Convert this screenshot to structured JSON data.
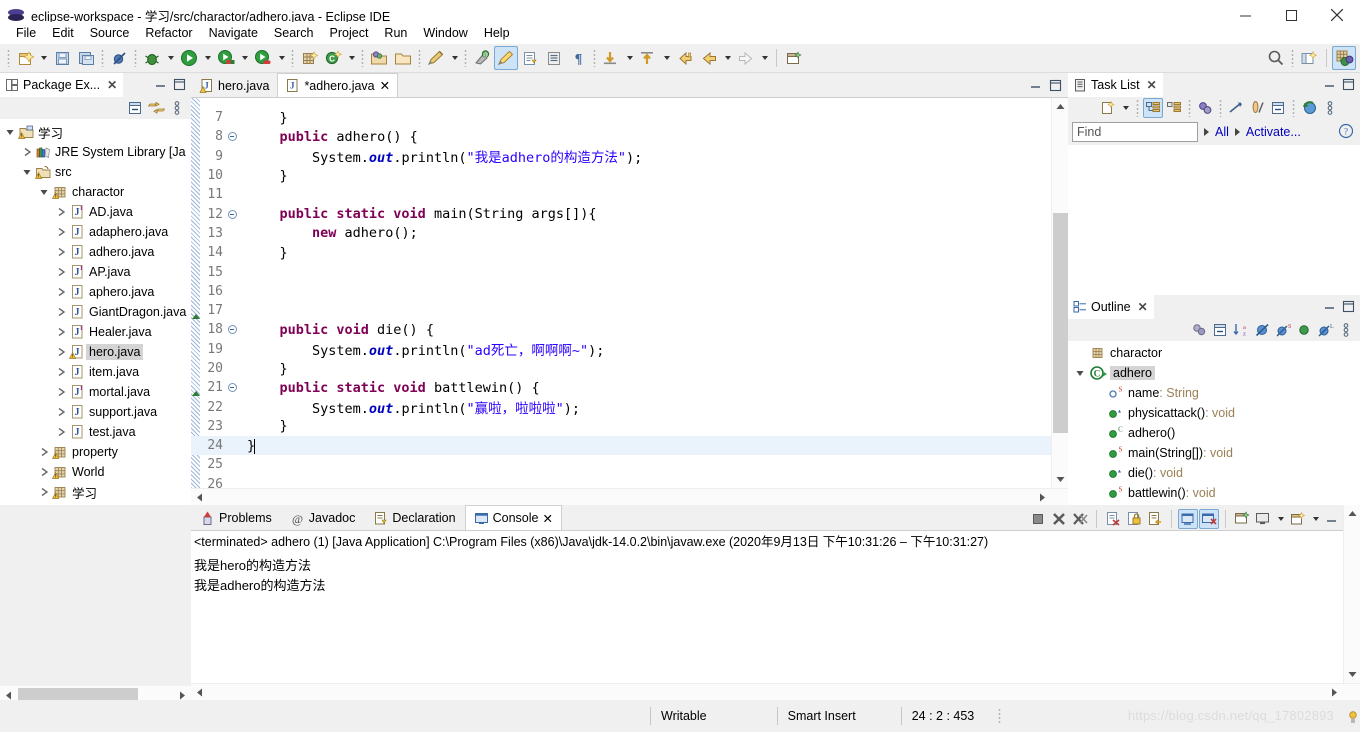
{
  "window": {
    "title": "eclipse-workspace - 学习/src/charactor/adhero.java - Eclipse IDE",
    "minimize_label": "Minimize",
    "maximize_label": "Restore",
    "close_label": "Close"
  },
  "menu": {
    "items": [
      {
        "label": "File"
      },
      {
        "label": "Edit"
      },
      {
        "label": "Source"
      },
      {
        "label": "Refactor"
      },
      {
        "label": "Navigate"
      },
      {
        "label": "Search"
      },
      {
        "label": "Project"
      },
      {
        "label": "Run"
      },
      {
        "label": "Window"
      },
      {
        "label": "Help"
      }
    ]
  },
  "toolbar": {
    "items": [
      {
        "name": "new-wizard",
        "tip": "New"
      },
      {
        "name": "save",
        "tip": "Save"
      },
      {
        "name": "save-all",
        "tip": "Save All"
      },
      {
        "name": "skip-all-breakpoints",
        "tip": "Skip All Breakpoints"
      },
      {
        "name": "debug",
        "tip": "Debug"
      },
      {
        "name": "run",
        "tip": "Run"
      },
      {
        "name": "run-coverage",
        "tip": "Coverage"
      },
      {
        "name": "run-external-tools",
        "tip": "External Tools"
      },
      {
        "name": "new-java-package",
        "tip": "New Java Package"
      },
      {
        "name": "new-java-class",
        "tip": "New Java Class"
      },
      {
        "name": "open-type",
        "tip": "Open Type"
      },
      {
        "name": "open-task",
        "tip": "Open Task"
      },
      {
        "name": "edit-annotation",
        "tip": "Annotation"
      },
      {
        "name": "search-previous",
        "tip": "Previous Annotation"
      },
      {
        "name": "toggle-mark-occurrences",
        "tip": "Toggle Mark Occurrences"
      },
      {
        "name": "link-to-editor",
        "tip": "Link"
      },
      {
        "name": "show-source-quick",
        "tip": "Show Source"
      },
      {
        "name": "show-whitespace",
        "tip": "Show Whitespace Characters"
      },
      {
        "name": "next-annotation",
        "tip": "Next Annotation"
      },
      {
        "name": "previous-annotation",
        "tip": "Previous Annotation"
      },
      {
        "name": "last-edit-location",
        "tip": "Last Edit Location"
      },
      {
        "name": "back",
        "tip": "Back"
      },
      {
        "name": "forward",
        "tip": "Forward"
      },
      {
        "name": "new-window",
        "tip": "New Window"
      }
    ],
    "right_items": [
      {
        "name": "search-icon",
        "tip": "Search"
      },
      {
        "name": "open-perspective",
        "tip": "Open Perspective"
      },
      {
        "name": "java-perspective",
        "tip": "Java"
      }
    ]
  },
  "package_explorer": {
    "title": "Package Ex...",
    "toolbar": [
      {
        "name": "collapse-all-icon",
        "tip": "Collapse All"
      },
      {
        "name": "link-with-editor-icon",
        "tip": "Link with Editor"
      },
      {
        "name": "view-menu-icon",
        "tip": "View Menu"
      }
    ],
    "tree": [
      {
        "label": "学习",
        "indent": 0,
        "twisty": "down",
        "icon": "java-project",
        "warn": true
      },
      {
        "label": "JRE System Library [Ja",
        "indent": 1,
        "twisty": "right",
        "icon": "library"
      },
      {
        "label": "src",
        "indent": 1,
        "twisty": "down",
        "icon": "source-folder",
        "warn": true
      },
      {
        "label": "charactor",
        "indent": 2,
        "twisty": "down",
        "icon": "package",
        "warn": true
      },
      {
        "label": "AD.java",
        "indent": 3,
        "twisty": "right",
        "icon": "interface-file"
      },
      {
        "label": "adaphero.java",
        "indent": 3,
        "twisty": "right",
        "icon": "class-file"
      },
      {
        "label": "adhero.java",
        "indent": 3,
        "twisty": "right",
        "icon": "class-file"
      },
      {
        "label": "AP.java",
        "indent": 3,
        "twisty": "right",
        "icon": "interface-file"
      },
      {
        "label": "aphero.java",
        "indent": 3,
        "twisty": "right",
        "icon": "class-file"
      },
      {
        "label": "GiantDragon.java",
        "indent": 3,
        "twisty": "right",
        "icon": "class-file"
      },
      {
        "label": "Healer.java",
        "indent": 3,
        "twisty": "right",
        "icon": "interface-file"
      },
      {
        "label": "hero.java",
        "indent": 3,
        "twisty": "right",
        "icon": "class-file",
        "warn": true,
        "selected": true
      },
      {
        "label": "item.java",
        "indent": 3,
        "twisty": "right",
        "icon": "class-file"
      },
      {
        "label": "mortal.java",
        "indent": 3,
        "twisty": "right",
        "icon": "interface-file"
      },
      {
        "label": "support.java",
        "indent": 3,
        "twisty": "right",
        "icon": "class-file"
      },
      {
        "label": "test.java",
        "indent": 3,
        "twisty": "right",
        "icon": "class-file"
      },
      {
        "label": "property",
        "indent": 2,
        "twisty": "right",
        "icon": "package",
        "warn": true
      },
      {
        "label": "World",
        "indent": 2,
        "twisty": "right",
        "icon": "package",
        "warn": true
      },
      {
        "label": "学习",
        "indent": 2,
        "twisty": "right",
        "icon": "package",
        "warn": true
      }
    ]
  },
  "editor": {
    "tabs": [
      {
        "label": "hero.java",
        "active": false,
        "warn": true,
        "dirty": false
      },
      {
        "label": "*adhero.java",
        "active": true,
        "warn": false,
        "dirty": true
      }
    ],
    "first_visible_line": 6,
    "cursor_line": 24,
    "lines": [
      {
        "n": 7,
        "fold": false,
        "tokens": [
          {
            "t": "    }",
            "c": "plain"
          }
        ]
      },
      {
        "n": 8,
        "fold": true,
        "tokens": [
          {
            "t": "    ",
            "c": "plain"
          },
          {
            "t": "public",
            "c": "kw"
          },
          {
            "t": " adhero() {",
            "c": "plain"
          }
        ]
      },
      {
        "n": 9,
        "fold": false,
        "tokens": [
          {
            "t": "        System.",
            "c": "plain"
          },
          {
            "t": "out",
            "c": "fld"
          },
          {
            "t": ".println(",
            "c": "plain"
          },
          {
            "t": "\"我是adhero的构造方法\"",
            "c": "str"
          },
          {
            "t": ");",
            "c": "plain"
          }
        ]
      },
      {
        "n": 10,
        "fold": false,
        "tokens": [
          {
            "t": "    }",
            "c": "plain"
          }
        ]
      },
      {
        "n": 11,
        "fold": false,
        "tokens": [
          {
            "t": "",
            "c": "plain"
          }
        ]
      },
      {
        "n": 12,
        "fold": true,
        "tokens": [
          {
            "t": "    ",
            "c": "plain"
          },
          {
            "t": "public static void",
            "c": "kw"
          },
          {
            "t": " main(String args[]){",
            "c": "plain"
          }
        ]
      },
      {
        "n": 13,
        "fold": false,
        "tokens": [
          {
            "t": "        ",
            "c": "plain"
          },
          {
            "t": "new",
            "c": "kw"
          },
          {
            "t": " adhero();",
            "c": "plain"
          }
        ]
      },
      {
        "n": 14,
        "fold": false,
        "tokens": [
          {
            "t": "    }",
            "c": "plain"
          }
        ]
      },
      {
        "n": 15,
        "fold": false,
        "tokens": [
          {
            "t": "",
            "c": "plain"
          }
        ]
      },
      {
        "n": 16,
        "fold": false,
        "tokens": [
          {
            "t": "",
            "c": "plain"
          }
        ]
      },
      {
        "n": 17,
        "fold": false,
        "tokens": [
          {
            "t": "",
            "c": "plain"
          }
        ]
      },
      {
        "n": 18,
        "fold": true,
        "tokens": [
          {
            "t": "    ",
            "c": "plain"
          },
          {
            "t": "public void",
            "c": "kw"
          },
          {
            "t": " die() {",
            "c": "plain"
          }
        ]
      },
      {
        "n": 19,
        "fold": false,
        "tokens": [
          {
            "t": "        System.",
            "c": "plain"
          },
          {
            "t": "out",
            "c": "fld"
          },
          {
            "t": ".println(",
            "c": "plain"
          },
          {
            "t": "\"ad死亡，啊啊啊~\"",
            "c": "str"
          },
          {
            "t": ");",
            "c": "plain"
          }
        ]
      },
      {
        "n": 20,
        "fold": false,
        "tokens": [
          {
            "t": "    }",
            "c": "plain"
          }
        ]
      },
      {
        "n": 21,
        "fold": true,
        "tokens": [
          {
            "t": "    ",
            "c": "plain"
          },
          {
            "t": "public static void",
            "c": "kw"
          },
          {
            "t": " battlewin() {",
            "c": "plain"
          }
        ]
      },
      {
        "n": 22,
        "fold": false,
        "tokens": [
          {
            "t": "        System.",
            "c": "plain"
          },
          {
            "t": "out",
            "c": "fld"
          },
          {
            "t": ".println(",
            "c": "plain"
          },
          {
            "t": "\"赢啦，啦啦啦\"",
            "c": "str"
          },
          {
            "t": ");",
            "c": "plain"
          }
        ]
      },
      {
        "n": 23,
        "fold": false,
        "tokens": [
          {
            "t": "    }",
            "c": "plain"
          }
        ]
      },
      {
        "n": 24,
        "fold": false,
        "cursor": true,
        "tokens": [
          {
            "t": "}",
            "c": "plain"
          }
        ]
      },
      {
        "n": 25,
        "fold": false,
        "tokens": [
          {
            "t": "",
            "c": "plain"
          }
        ]
      },
      {
        "n": 26,
        "fold": false,
        "tokens": [
          {
            "t": "",
            "c": "plain"
          }
        ]
      }
    ]
  },
  "console": {
    "tabs": [
      {
        "label": "Problems",
        "icon": "problems-icon",
        "active": false
      },
      {
        "label": "Javadoc",
        "icon": "javadoc-icon",
        "active": false
      },
      {
        "label": "Declaration",
        "icon": "declaration-icon",
        "active": false
      },
      {
        "label": "Console",
        "icon": "console-icon",
        "active": true
      }
    ],
    "launch_header": "<terminated> adhero (1) [Java Application] C:\\Program Files (x86)\\Java\\jdk-14.0.2\\bin\\javaw.exe  (2020年9月13日 下午10:31:26 – 下午10:31:27)",
    "output": [
      "我是hero的构造方法",
      "我是adhero的构造方法"
    ],
    "toolbar": [
      {
        "name": "terminate-icon",
        "tip": "Terminate"
      },
      {
        "name": "remove-launch-icon",
        "tip": "Remove Launch"
      },
      {
        "name": "remove-all-launches-icon",
        "tip": "Remove All Terminated Launches"
      },
      {
        "name": "clear-console-icon",
        "tip": "Clear Console"
      },
      {
        "name": "scroll-lock-icon",
        "tip": "Scroll Lock"
      },
      {
        "name": "word-wrap-icon",
        "tip": "Word Wrap"
      },
      {
        "name": "show-console-on-output-icon",
        "tip": "Show Console When Standard Out Changes"
      },
      {
        "name": "show-console-on-error-icon",
        "tip": "Show Console When Standard Error Changes"
      },
      {
        "name": "pin-console-icon",
        "tip": "Pin Console"
      },
      {
        "name": "display-selected-console-icon",
        "tip": "Display Selected Console"
      },
      {
        "name": "open-console-icon",
        "tip": "Open Console"
      }
    ]
  },
  "task_list": {
    "title": "Task List",
    "find_placeholder": "Find",
    "find_value": "",
    "filter_all": "All",
    "activate_link": "Activate...",
    "toolbar": [
      {
        "name": "new-task-icon",
        "tip": "New Task"
      },
      {
        "name": "categorized-presentation-icon",
        "tip": "Categorized"
      },
      {
        "name": "scheduled-presentation-icon",
        "tip": "Scheduled"
      },
      {
        "name": "synchronize-icon",
        "tip": "Synchronize Changed"
      },
      {
        "name": "focus-on-workweek-icon",
        "tip": "Focus on Workweek"
      },
      {
        "name": "show-ui-legend-icon",
        "tip": "Show UI Legend"
      },
      {
        "name": "collapse-all-icon",
        "tip": "Collapse All"
      },
      {
        "name": "restore-tasks-icon",
        "tip": "Restore Tasks"
      },
      {
        "name": "view-menu-icon",
        "tip": "View Menu"
      },
      {
        "name": "help-icon",
        "tip": "Help"
      }
    ]
  },
  "outline": {
    "title": "Outline",
    "toolbar": [
      {
        "name": "focus-on-active-task-icon",
        "tip": "Focus on Active Task"
      },
      {
        "name": "collapse-all-icon",
        "tip": "Collapse All"
      },
      {
        "name": "sort-icon",
        "tip": "Sort"
      },
      {
        "name": "hide-fields-icon",
        "tip": "Hide Fields"
      },
      {
        "name": "hide-static-icon",
        "tip": "Hide Static Members"
      },
      {
        "name": "hide-nonpublic-icon",
        "tip": "Hide Non-Public Members"
      },
      {
        "name": "hide-local-types-icon",
        "tip": "Hide Local Types"
      },
      {
        "name": "view-menu-icon",
        "tip": "View Menu"
      }
    ],
    "items": [
      {
        "label": "charactor",
        "type": "",
        "indent": 0,
        "icon": "package",
        "twisty": ""
      },
      {
        "label": "adhero",
        "type": "",
        "indent": 0,
        "icon": "class",
        "twisty": "down",
        "selected": true
      },
      {
        "label": "name",
        "type": " : String",
        "indent": 1,
        "icon": "field-default",
        "badge": "S"
      },
      {
        "label": "physicattack()",
        "type": " : void",
        "indent": 1,
        "icon": "method-public",
        "badge": "tri"
      },
      {
        "label": "adhero()",
        "type": "",
        "indent": 1,
        "icon": "method-public",
        "badge": "C"
      },
      {
        "label": "main(String[])",
        "type": " : void",
        "indent": 1,
        "icon": "method-public",
        "badge": "S"
      },
      {
        "label": "die()",
        "type": " : void",
        "indent": 1,
        "icon": "method-public",
        "badge": "tri"
      },
      {
        "label": "battlewin()",
        "type": " : void",
        "indent": 1,
        "icon": "method-public",
        "badge": "S"
      }
    ]
  },
  "status_bar": {
    "writable": "Writable",
    "insert_mode": "Smart Insert",
    "position": "24 : 2 : 453",
    "watermark": "https://blog.csdn.net/qq_17802893"
  }
}
